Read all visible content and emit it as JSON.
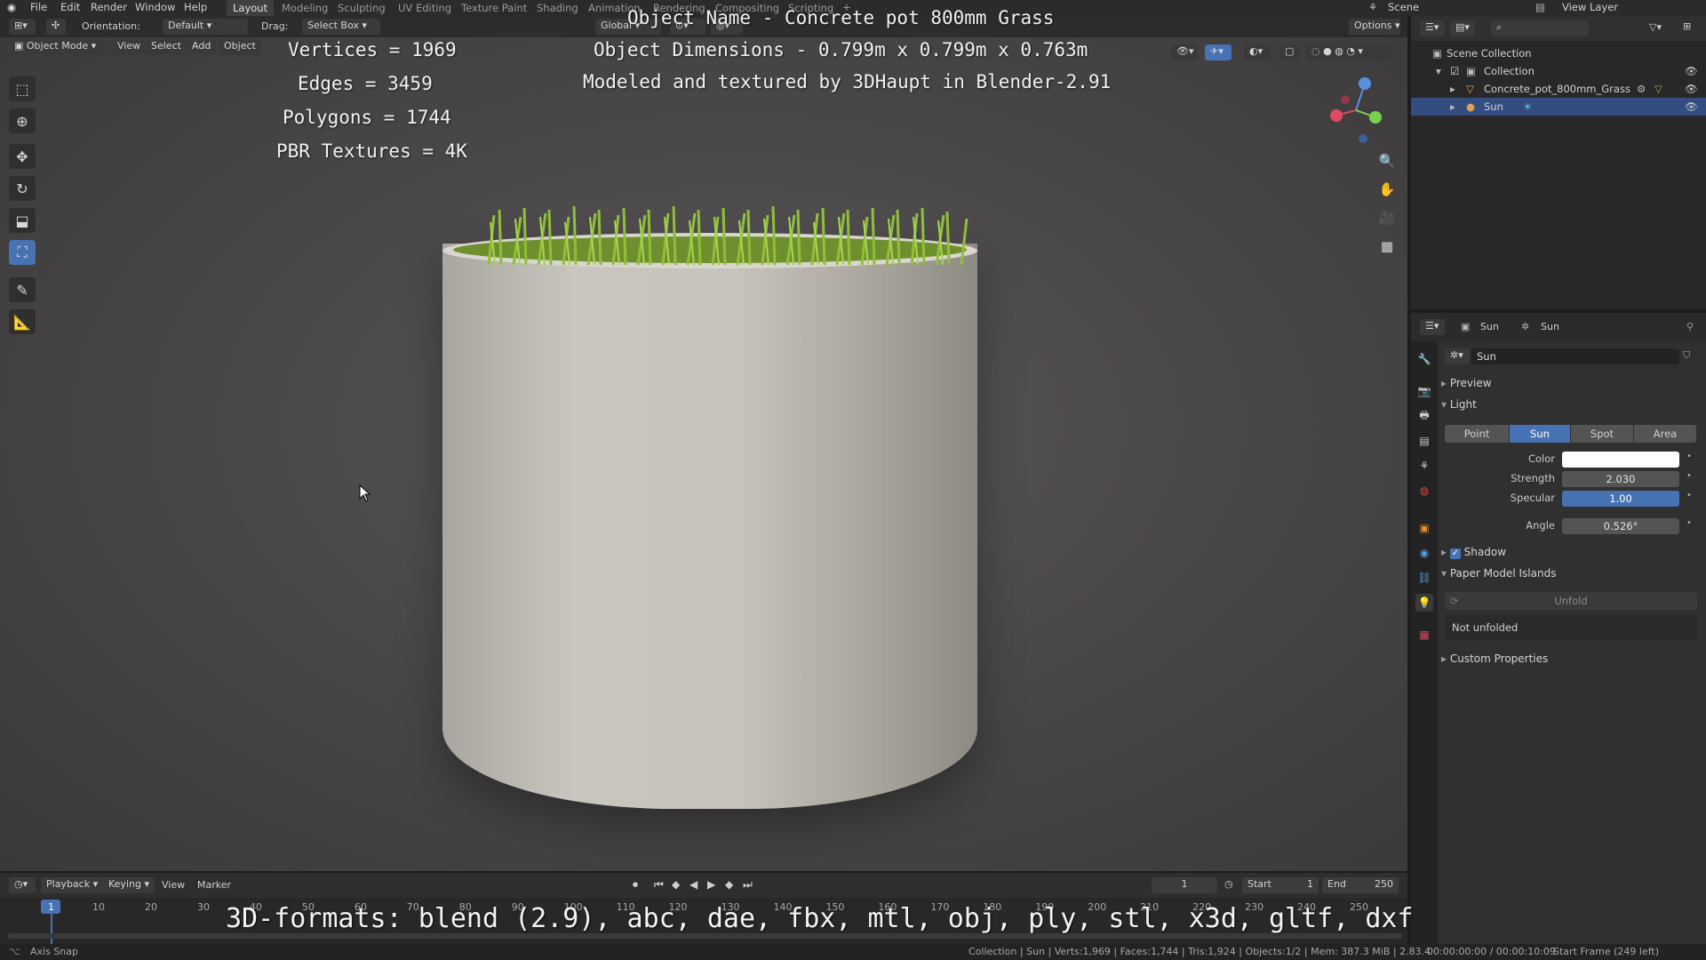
{
  "menu": {
    "items": [
      "File",
      "Edit",
      "Render",
      "Window",
      "Help"
    ],
    "workspaces": [
      "Layout",
      "Modeling",
      "Sculpting",
      "UV Editing",
      "Texture Paint",
      "Shading",
      "Animation",
      "Rendering",
      "Compositing",
      "Scripting"
    ],
    "active_workspace": "Layout",
    "scene_label": "Scene",
    "view_layer_label": "View Layer"
  },
  "viewport_header": {
    "orientation_label": "Orientation:",
    "orientation_value": "Default",
    "drag_label": "Drag:",
    "drag_value": "Select Box",
    "transform_orientation": "Global",
    "options_label": "Options",
    "mode": "Object Mode",
    "menus": [
      "View",
      "Select",
      "Add",
      "Object"
    ]
  },
  "overlay": {
    "stats": [
      "Vertices = 1969",
      "Edges = 3459",
      "Polygons = 1744",
      "PBR Textures = 4K"
    ],
    "object_name": "Object Name - Concrete pot 800mm Grass",
    "object_dimensions": "Object Dimensions -  0.799m x 0.799m x 0.763m",
    "credit": "Modeled and textured by 3DHaupt in Blender-2.91",
    "formats": "3D-formats: blend (2.9), abc, dae, fbx, mtl, obj, ply, stl, x3d, gltf, dxf"
  },
  "outliner": {
    "rows": [
      {
        "label": "Scene Collection"
      },
      {
        "label": "Collection"
      },
      {
        "label": "Concrete_pot_800mm_Grass"
      },
      {
        "label": "Sun"
      }
    ]
  },
  "properties": {
    "header_object": "Sun",
    "header_data": "Sun",
    "datablock_name": "Sun",
    "sections": {
      "preview": "Preview",
      "light": "Light",
      "shadow": "Shadow",
      "paper_model": "Paper Model Islands",
      "custom": "Custom Properties"
    },
    "light_types": [
      "Point",
      "Sun",
      "Spot",
      "Area"
    ],
    "active_light_type": "Sun",
    "fields": {
      "color_label": "Color",
      "strength_label": "Strength",
      "strength_value": "2.030",
      "specular_label": "Specular",
      "specular_value": "1.00",
      "angle_label": "Angle",
      "angle_value": "0.526°"
    },
    "shadow_checked": true,
    "unfold_label": "Unfold",
    "not_unfolded": "Not unfolded",
    "colors": {
      "light_color": "#ffffff",
      "accent": "#4772b3"
    }
  },
  "timeline": {
    "menus": [
      "Playback",
      "Keying",
      "View",
      "Marker"
    ],
    "current_frame": "1",
    "start_label": "Start",
    "start_value": "1",
    "end_label": "End",
    "end_value": "250",
    "ticks": [
      "1",
      "10",
      "20",
      "30",
      "40",
      "50",
      "60",
      "70",
      "80",
      "90",
      "100",
      "110",
      "120",
      "130",
      "140",
      "150",
      "160",
      "170",
      "180",
      "190",
      "200",
      "210",
      "220",
      "230",
      "240",
      "250"
    ]
  },
  "status": {
    "left": "Axis Snap",
    "stats": "Collection | Sun | Verts:1,969 | Faces:1,744 | Tris:1,924 | Objects:1/2 | Mem: 387.3 MiB | 2.83.4",
    "time": "00:00:00:00 / 00:00:10:09",
    "frame_info": "Start Frame (249 left)"
  }
}
